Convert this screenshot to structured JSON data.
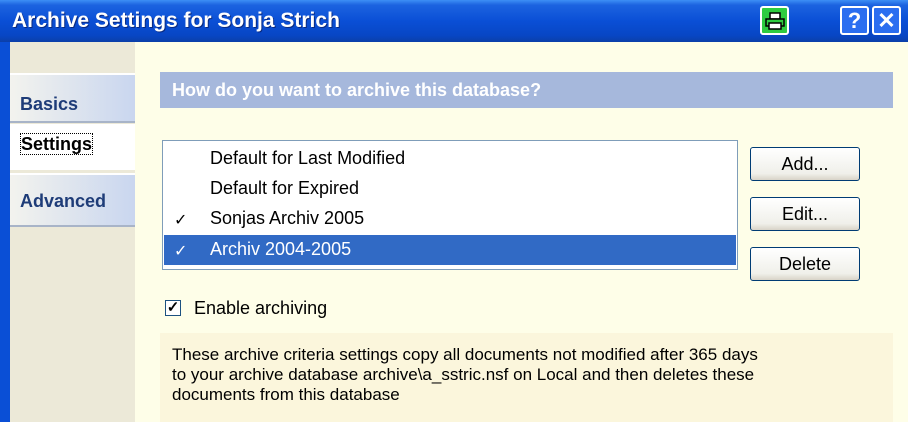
{
  "window": {
    "title": "Archive Settings for Sonja Strich"
  },
  "titlebar_buttons": {
    "help": "?",
    "close": "✕"
  },
  "tabs": [
    {
      "label": "Basics"
    },
    {
      "label": "Settings"
    },
    {
      "label": "Advanced"
    }
  ],
  "header": "How do you want to archive this database?",
  "criteria_list": [
    {
      "label": "Default for Last Modified",
      "checked": false,
      "selected": false
    },
    {
      "label": "Default for Expired",
      "checked": false,
      "selected": false
    },
    {
      "label": "Sonjas Archiv 2005",
      "checked": true,
      "selected": false
    },
    {
      "label": "Archiv 2004-2005",
      "checked": true,
      "selected": true
    }
  ],
  "check_glyph": "✓",
  "buttons": {
    "add": "Add...",
    "edit": "Edit...",
    "delete": "Delete"
  },
  "enable_archiving": {
    "label": "Enable archiving",
    "checked": true,
    "glyph": "✓"
  },
  "info_lines": [
    "These archive criteria settings copy all documents not modified after 365 days",
    "to your archive database archive\\a_sstric.nsf on Local and then deletes these",
    "documents from this database"
  ]
}
